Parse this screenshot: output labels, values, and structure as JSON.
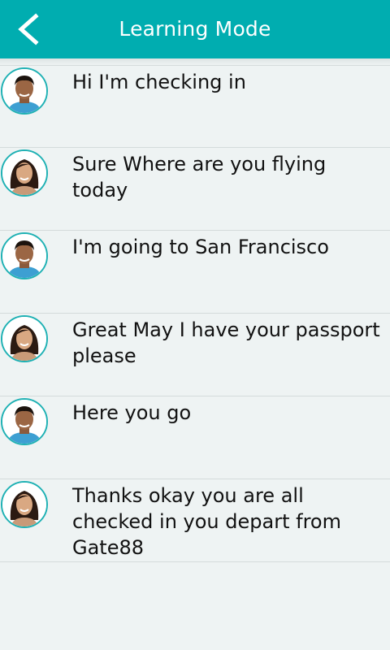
{
  "header": {
    "title": "Learning Mode",
    "back_icon": "chevron-left-icon"
  },
  "colors": {
    "app_bar": "#00adb0",
    "avatar_ring": "#1fb1b4",
    "background": "#eef3f3"
  },
  "conversation": {
    "lines": [
      {
        "speaker": "man",
        "text": "Hi I'm checking in"
      },
      {
        "speaker": "woman",
        "text": "Sure Where are you flying today"
      },
      {
        "speaker": "man",
        "text": "I'm going to San Francisco"
      },
      {
        "speaker": "woman",
        "text": "Great May I have your passport please"
      },
      {
        "speaker": "man",
        "text": "Here you go"
      },
      {
        "speaker": "woman",
        "text": "Thanks okay you are all checked in you depart from Gate88"
      }
    ]
  }
}
